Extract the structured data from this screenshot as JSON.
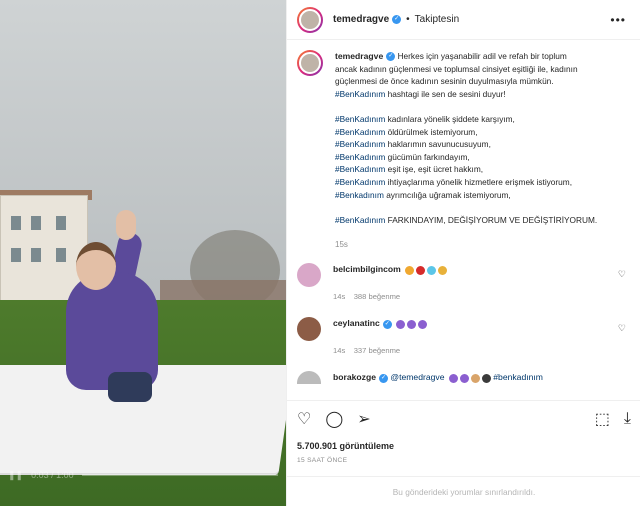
{
  "header": {
    "username": "temedragve",
    "follow_status": "Takiptesin",
    "more": "•••"
  },
  "caption": {
    "username": "temedragve",
    "lines": [
      "Herkes için yaşanabilir adil ve refah bir toplum",
      "ancak kadının güçlenmesi ve toplumsal cinsiyet eşitliği ile, kadının",
      "güçlenmesi de önce kadının sesinin duyulmasıyla mümkün."
    ],
    "hashtag_line": {
      "tag": "#BenKadınım",
      "text": " hashtagi ile sen de sesini duyur!"
    },
    "items": [
      {
        "tag": "#BenKadınım",
        "text": " kadınlara yönelik şiddete karşıyım,"
      },
      {
        "tag": "#BenKadınım",
        "text": " öldürülmek istemiyorum,"
      },
      {
        "tag": "#BenKadınım",
        "text": " haklarımın savunucusuyum,"
      },
      {
        "tag": "#BenKadınım",
        "text": " gücümün farkındayım,"
      },
      {
        "tag": "#BenKadınım",
        "text": " eşit işe, eşit ücret hakkım,"
      },
      {
        "tag": "#BenKadınım",
        "text": " ihtiyaçlarıma yönelik hizmetlere erişmek istiyorum,"
      },
      {
        "tag": "#Benkadınım",
        "text": " ayrımcılığa uğramak istemiyorum,"
      }
    ],
    "final": {
      "tag": "#BenKadınım",
      "text": " FARKINDAYIM, DEĞİŞİYORUM VE DEĞİŞTİRİYORUM."
    },
    "time": "15s"
  },
  "comments": [
    {
      "username": "belcimbilgincom",
      "verified": false,
      "text": "",
      "emoji_colors": [
        "#f0a830",
        "#d62b2b",
        "#5bc6e8",
        "#e8b13a"
      ],
      "time": "14s",
      "likes": "388 beğenme"
    },
    {
      "username": "ceylanatinc",
      "verified": true,
      "text": "",
      "emoji_colors": [
        "#8b5fd0",
        "#8b5fd0",
        "#8b5fd0"
      ],
      "time": "14s",
      "likes": "337 beğenme"
    },
    {
      "username": "borakozge",
      "verified": true,
      "text": "@temedragve",
      "text2": "#benkadınım",
      "emoji_colors": [
        "#8b5fd0",
        "#8b5fd0",
        "#d9a46a",
        "#3b3b3b"
      ],
      "time": "",
      "likes": ""
    }
  ],
  "actions": {
    "views": "5.700.901 görüntüleme",
    "ago": "15 SAAT ÖNCE"
  },
  "limited_text": "Bu gönderideki yorumlar sınırlandırıldı.",
  "video": {
    "timestamp": "0:03 / 1:00"
  }
}
